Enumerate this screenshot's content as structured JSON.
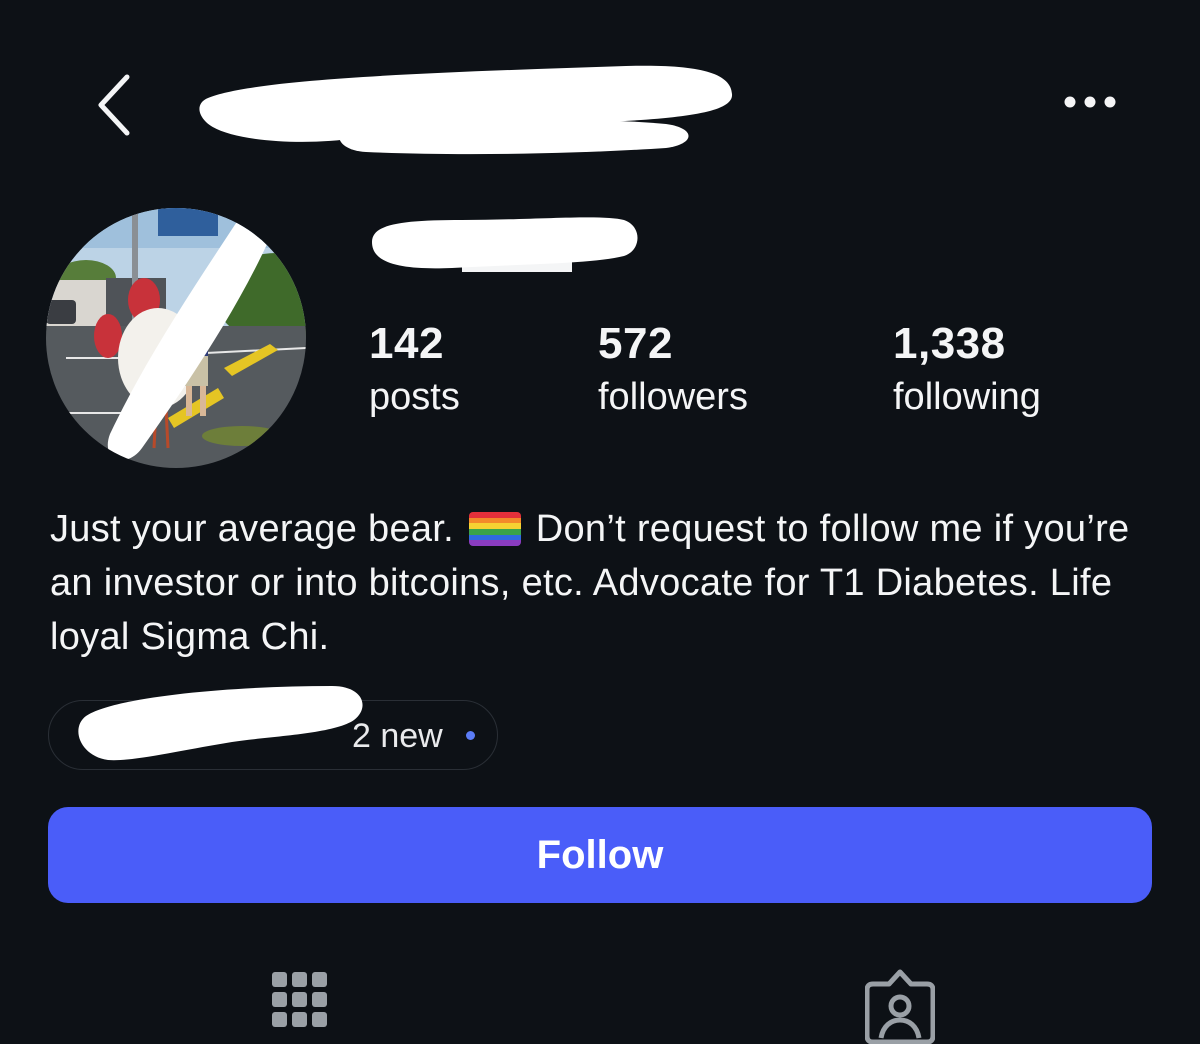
{
  "header": {
    "back_icon": "chevron-left-icon",
    "username_redacted": true,
    "more_icon": "more-horizontal-icon"
  },
  "profile": {
    "avatar_redacted": true,
    "display_name_redacted": true
  },
  "stats": {
    "posts": {
      "value": "142",
      "label": "posts"
    },
    "followers": {
      "value": "572",
      "label": "followers"
    },
    "following": {
      "value": "1,338",
      "label": "following"
    }
  },
  "bio": {
    "part1": "Just your average bear.",
    "flag_emoji": "rainbow-flag",
    "part2": "Don’t request to follow me if you’re an investor or into bitcoins, etc. Advocate for T1 Diabetes. Life loyal Sigma Chi."
  },
  "link_chip": {
    "text": "2 new",
    "redacted_prefix": true,
    "dot_color": "#5b7cf6"
  },
  "follow_button": {
    "label": "Follow",
    "color": "#4a5df9"
  },
  "tabs": [
    {
      "icon": "grid-icon"
    },
    {
      "icon": "tagged-person-icon"
    }
  ]
}
